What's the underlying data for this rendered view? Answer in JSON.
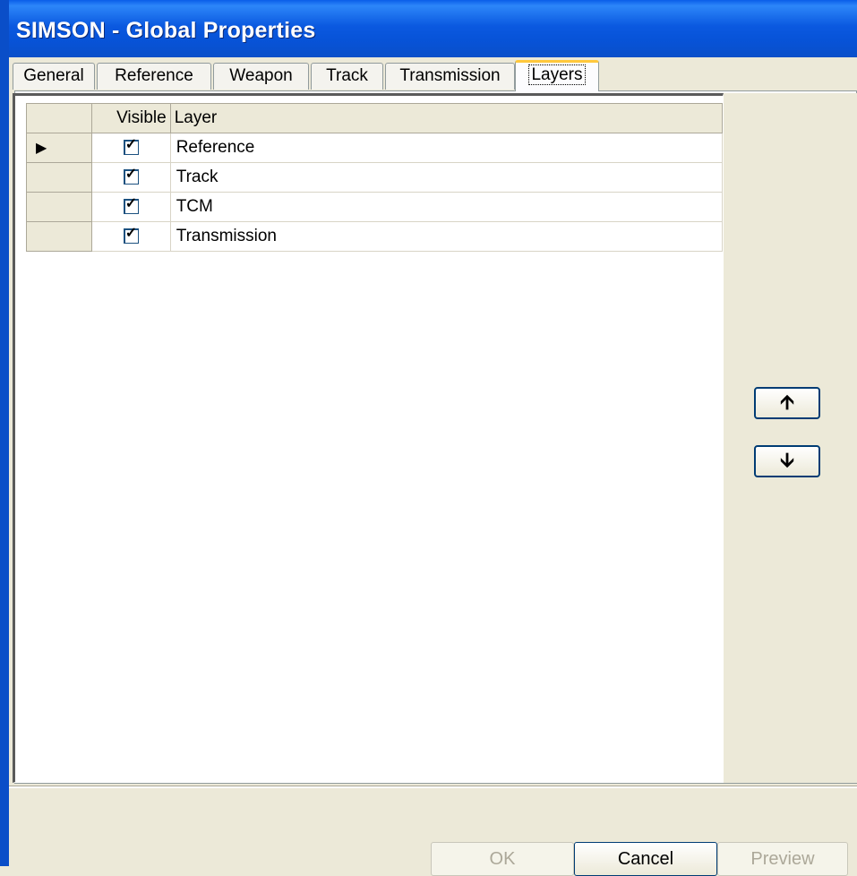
{
  "window": {
    "title": "SIMSON - Global Properties"
  },
  "tabs": [
    {
      "label": "General"
    },
    {
      "label": "Reference"
    },
    {
      "label": "Weapon"
    },
    {
      "label": "Track"
    },
    {
      "label": "Transmission"
    },
    {
      "label": "Layers",
      "active": true
    }
  ],
  "grid": {
    "headers": {
      "visible": "Visible",
      "layer": "Layer"
    },
    "rows": [
      {
        "visible": true,
        "layer": "Reference",
        "current": true
      },
      {
        "visible": true,
        "layer": "Track",
        "current": false
      },
      {
        "visible": true,
        "layer": "TCM",
        "current": false
      },
      {
        "visible": true,
        "layer": "Transmission",
        "current": false
      }
    ]
  },
  "side_buttons": {
    "up": "arrow-up-icon",
    "down": "arrow-down-icon"
  },
  "buttons": {
    "ok": "OK",
    "cancel": "Cancel",
    "preview": "Preview"
  }
}
